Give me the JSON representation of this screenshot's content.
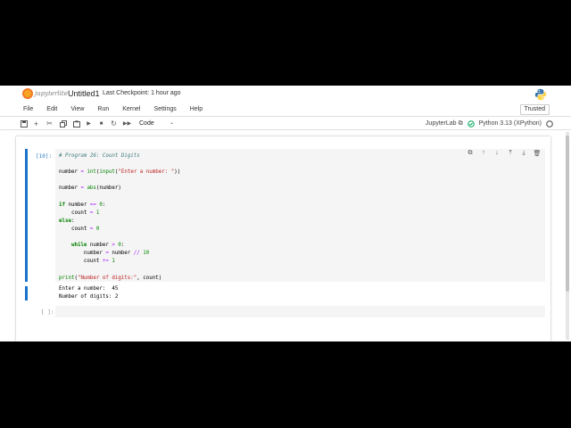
{
  "app": {
    "logo_text": "jupyterlite",
    "document_title": "Untitled1",
    "checkpoint": "Last Checkpoint: 1 hour ago"
  },
  "menu": [
    "File",
    "Edit",
    "View",
    "Run",
    "Kernel",
    "Settings",
    "Help"
  ],
  "trusted_label": "Trusted",
  "toolbar": {
    "icons": [
      "save-icon",
      "add-cell-icon",
      "cut-icon",
      "copy-icon",
      "paste-icon",
      "run-icon",
      "stop-icon",
      "restart-icon",
      "fast-forward-icon"
    ],
    "cell_type": "Code",
    "jupyterlab_label": "JupyterLab",
    "kernel_name": "Python 3.13 (XPython)",
    "kernel_status_color": "#00a65a"
  },
  "cells": [
    {
      "prompt": "[10]:",
      "code": [
        "# Program 26: Count Digits",
        "",
        "number = int(input(\"Enter a number: \"))",
        "",
        "number = abs(number)",
        "",
        "if number == 0:",
        "    count = 1",
        "else:",
        "    count = 0",
        "",
        "    while number > 0:",
        "        number = number // 10",
        "        count += 1",
        "",
        "print(\"Number of digits:\", count)"
      ],
      "output": [
        "Enter a number:  45",
        "Number of digits: 2"
      ]
    },
    {
      "prompt": "[ ]:",
      "code": [],
      "output": []
    }
  ],
  "accent_color": "#1a73c9"
}
